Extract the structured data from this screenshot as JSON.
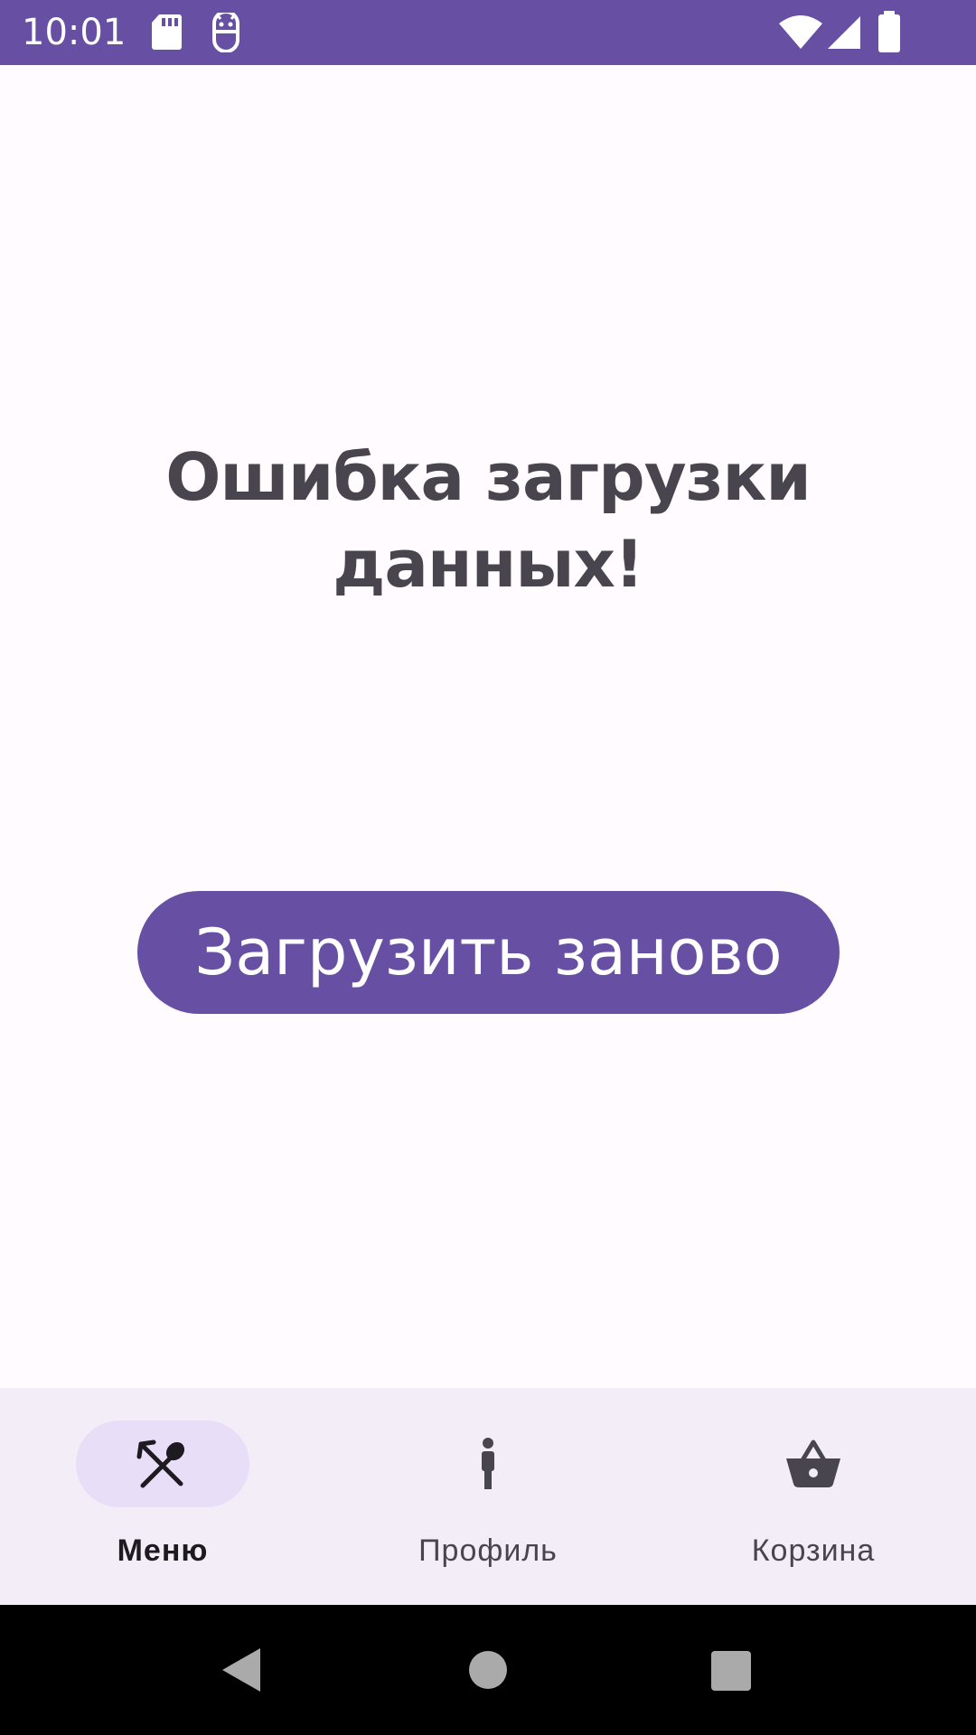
{
  "status_bar": {
    "time": "10:01",
    "background_color": "#6750A4",
    "icons": [
      "sd-card-icon",
      "app-notification-icon",
      "wifi-icon",
      "signal-icon",
      "battery-icon"
    ]
  },
  "main": {
    "error_title": "Ошибка загрузки данных!",
    "reload_button_label": "Загрузить заново",
    "button_color": "#6750A4"
  },
  "bottom_nav": {
    "items": [
      {
        "label": "Меню",
        "icon": "fork-spoon-icon",
        "active": true
      },
      {
        "label": "Профиль",
        "icon": "person-icon",
        "active": false
      },
      {
        "label": "Корзина",
        "icon": "basket-icon",
        "active": false
      }
    ],
    "background_color": "#F3EDF7",
    "indicator_color": "#E8DEF8"
  },
  "system_nav": {
    "buttons": [
      "back-icon",
      "home-icon",
      "recents-icon"
    ]
  }
}
